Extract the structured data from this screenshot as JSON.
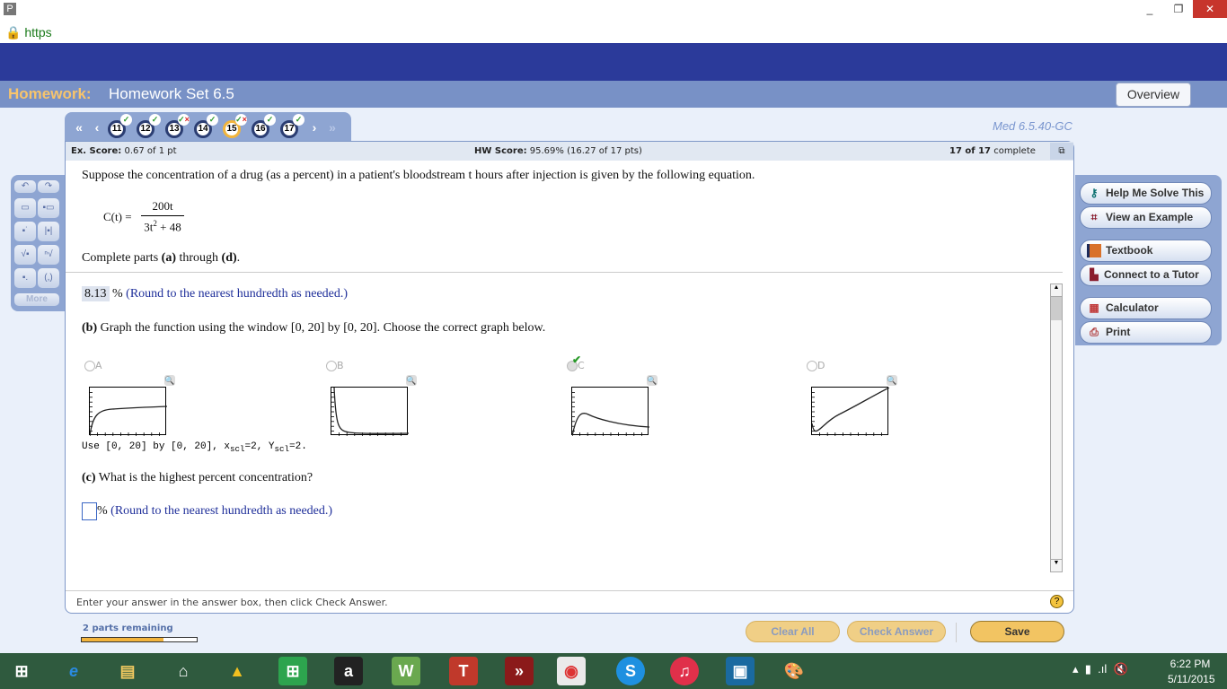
{
  "browser": {
    "app_icon": "P",
    "url_prefix": "https",
    "controls": [
      "minimize",
      "restore",
      "close"
    ]
  },
  "header": {
    "label": "Homework:",
    "title": "Homework Set 6.5",
    "overview": "Overview"
  },
  "nav": {
    "questions": [
      {
        "n": "11",
        "status": "correct"
      },
      {
        "n": "12",
        "status": "correct"
      },
      {
        "n": "13",
        "status": "partial"
      },
      {
        "n": "14",
        "status": "correct"
      },
      {
        "n": "15",
        "status": "partial",
        "current": true
      },
      {
        "n": "16",
        "status": "correct"
      },
      {
        "n": "17",
        "status": "correct"
      }
    ],
    "question_id": "Med 6.5.40-GC"
  },
  "score": {
    "ex_label": "Ex. Score:",
    "ex_value": "0.67 of 1 pt",
    "hw_label": "HW Score:",
    "hw_value": "95.69% (16.27 of 17 pts)",
    "complete_bold": "17 of 17",
    "complete": "complete"
  },
  "question": {
    "intro": "Suppose the concentration of a drug (as a percent) in a patient's bloodstream t hours after injection is given by the following equation.",
    "lhs": "C(t) =",
    "numerator": "200t",
    "denominator": "3t",
    "exp": "2",
    "denominator_rest": " + 48",
    "parts_text_pre": "Complete parts ",
    "a": "(a)",
    "through": " through ",
    "d": "(d)",
    "period": "."
  },
  "part_a": {
    "answer": "8.13",
    "unit": "%",
    "hint": "(Round to the nearest hundredth as needed.)"
  },
  "part_b": {
    "label": "(b)",
    "text": " Graph the function using the window [0, 20] by [0, 20]. Choose the correct graph below.",
    "options": [
      "A",
      "B",
      "C",
      "D"
    ],
    "selected": "C",
    "note": "Use [0, 20] by [0, 20], x",
    "sub": "scl",
    "note2": "=2, Y",
    "note3": "=2."
  },
  "part_c": {
    "label": "(c)",
    "text": " What is the highest percent concentration?",
    "unit": "%",
    "hint": "(Round to the nearest hundredth as needed.)",
    "answer": ""
  },
  "footer": {
    "instruction": "Enter your answer in the answer box, then click Check Answer.",
    "help": "?"
  },
  "right_tools": [
    "Help Me Solve This",
    "View an Example",
    "Textbook",
    "Connect to a Tutor",
    "Calculator",
    "Print"
  ],
  "left_tools": {
    "more": "More"
  },
  "bottom": {
    "remaining": "2 parts remaining",
    "progress": 0.71,
    "clear": "Clear All",
    "check": "Check Answer",
    "save": "Save"
  },
  "taskbar": {
    "time": "6:22 PM",
    "date": "5/11/2015"
  }
}
